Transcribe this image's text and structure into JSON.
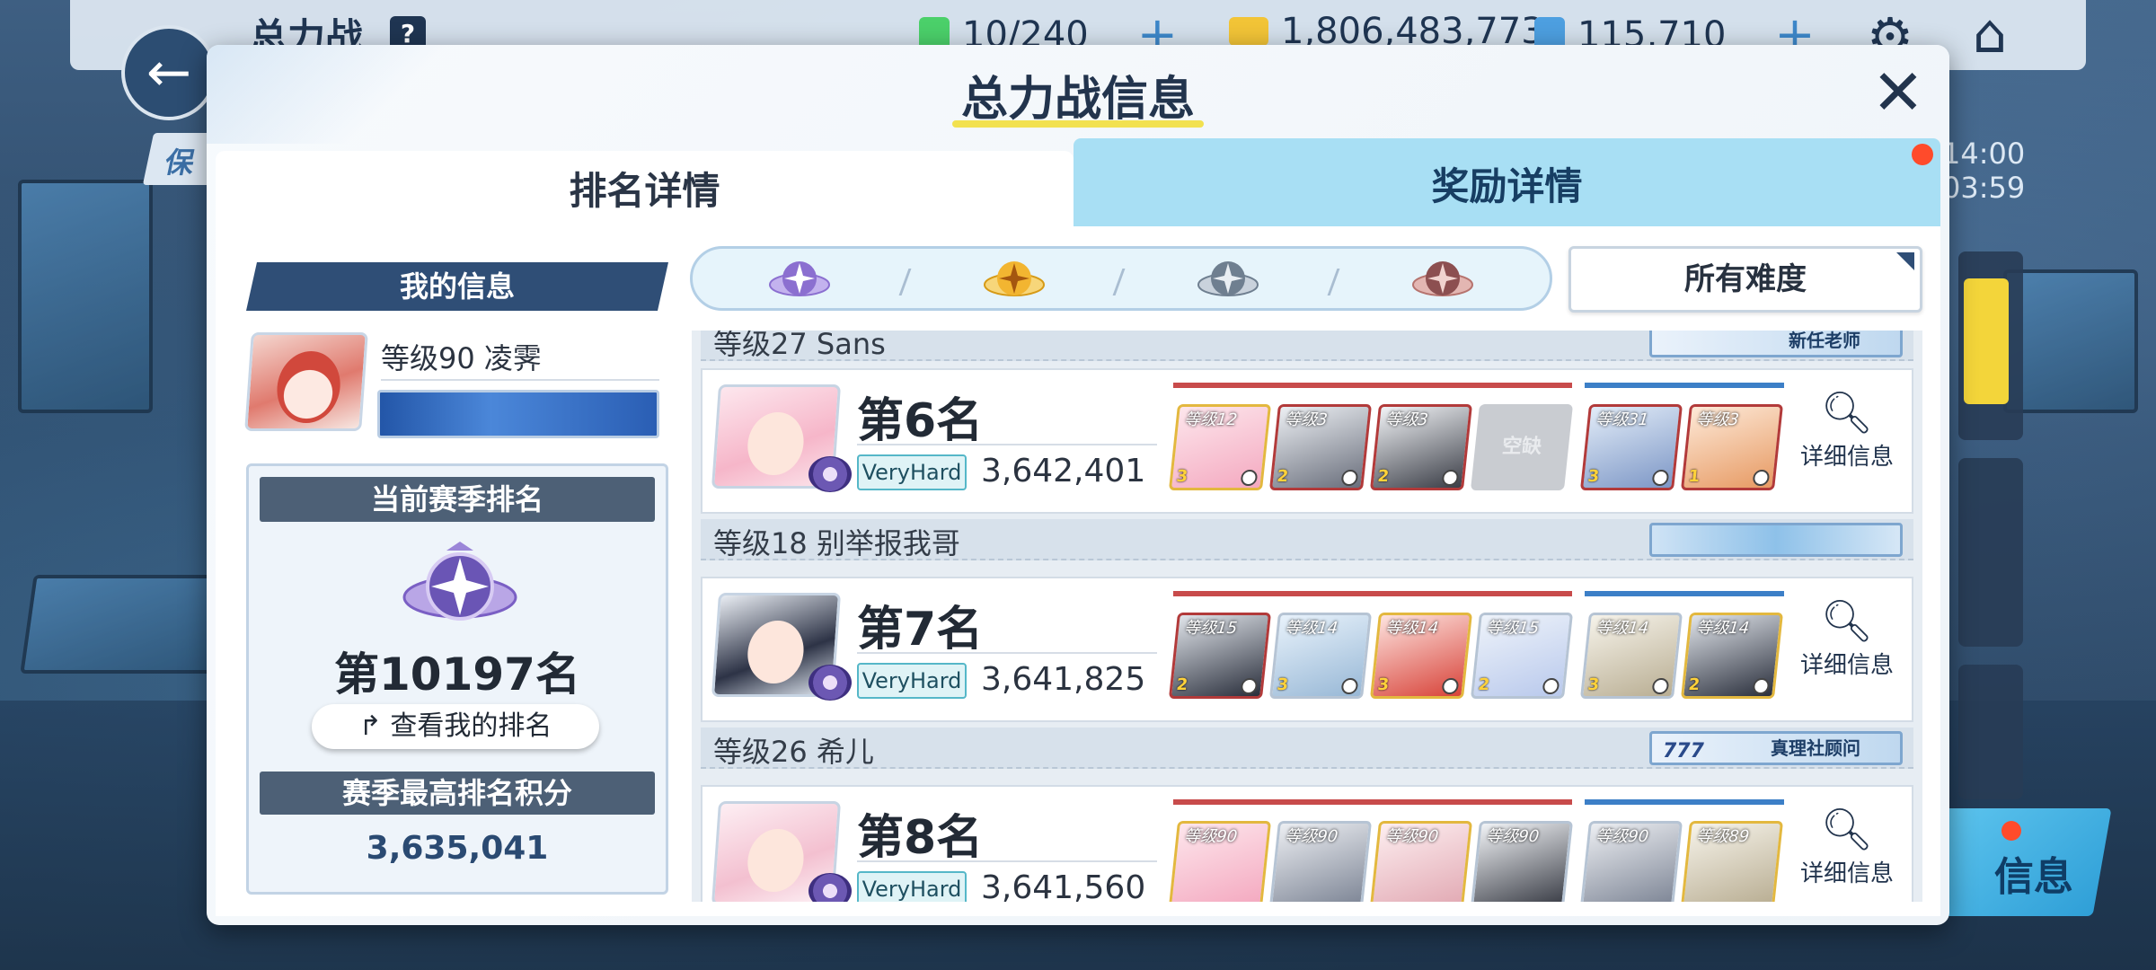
{
  "background": {
    "top_title": "总力战",
    "help_label": "?",
    "resources": [
      {
        "icon": "stamina-icon",
        "value": "10/240",
        "color": "#4bd06a"
      },
      {
        "icon": "credit-icon",
        "value": "1,806,483,773",
        "color": "#f2c437"
      },
      {
        "icon": "pyroxene-icon",
        "value": "115,710",
        "color": "#4d9fe0"
      }
    ],
    "left_tag": "保",
    "times": [
      "14:00",
      "03:59"
    ],
    "right_button": "信息"
  },
  "modal": {
    "title": "总力战信息",
    "close_glyph": "✕"
  },
  "tabs": [
    {
      "label": "排名详情",
      "active": true
    },
    {
      "label": "奖励详情",
      "active": false
    }
  ],
  "my_info": {
    "header": "我的信息",
    "name_line": "等级90 凌霁",
    "season_rank_header": "当前赛季排名",
    "season_rank": "第10197名",
    "view_rank_button": "查看我的排名",
    "best_score_header": "赛季最高排名积分",
    "best_score": "3,635,041"
  },
  "filters": {
    "emblems": [
      {
        "name": "platinum",
        "color": "#8b6fd0"
      },
      {
        "name": "gold",
        "color": "#f2b531"
      },
      {
        "name": "silver",
        "color": "#6f7f90"
      },
      {
        "name": "bronze",
        "color": "#b6736e"
      }
    ],
    "difficulty_select": "所有难度"
  },
  "ranking": {
    "top_partial_name": "等级27 Sans",
    "top_partial_title": "新任老师",
    "entries": [
      {
        "rank": "第6名",
        "difficulty": "VeryHard",
        "score": "3,642,401",
        "player": "等级18 别举报我哥",
        "title": "",
        "red_team": [
          {
            "level": "等级12",
            "star": "3"
          },
          {
            "level": "等级3",
            "star": "2"
          },
          {
            "level": "等级3",
            "star": "2"
          },
          {
            "level": "",
            "star": "",
            "empty_label": "空缺"
          }
        ],
        "blue_team": [
          {
            "level": "等级31",
            "star": "3"
          },
          {
            "level": "等级3",
            "star": "1"
          }
        ],
        "detail_label": "详细信息"
      },
      {
        "rank": "第7名",
        "difficulty": "VeryHard",
        "score": "3,641,825",
        "player": "等级26 希儿",
        "title": "真理社顾问",
        "title_logo": "777",
        "red_team": [
          {
            "level": "等级15",
            "star": "2"
          },
          {
            "level": "等级14",
            "star": "3"
          },
          {
            "level": "等级14",
            "star": "3"
          },
          {
            "level": "等级15",
            "star": "2"
          }
        ],
        "blue_team": [
          {
            "level": "等级14",
            "star": "3"
          },
          {
            "level": "等级14",
            "star": "2"
          }
        ],
        "detail_label": "详细信息"
      },
      {
        "rank": "第8名",
        "difficulty": "VeryHard",
        "score": "3,641,560",
        "player": "",
        "title": "",
        "red_team": [
          {
            "level": "等级90",
            "star": ""
          },
          {
            "level": "等级90",
            "star": ""
          },
          {
            "level": "等级90",
            "star": ""
          },
          {
            "level": "等级90",
            "star": ""
          }
        ],
        "blue_team": [
          {
            "level": "等级90",
            "star": ""
          },
          {
            "level": "等级89",
            "star": ""
          }
        ],
        "detail_label": "详细信息"
      }
    ]
  }
}
